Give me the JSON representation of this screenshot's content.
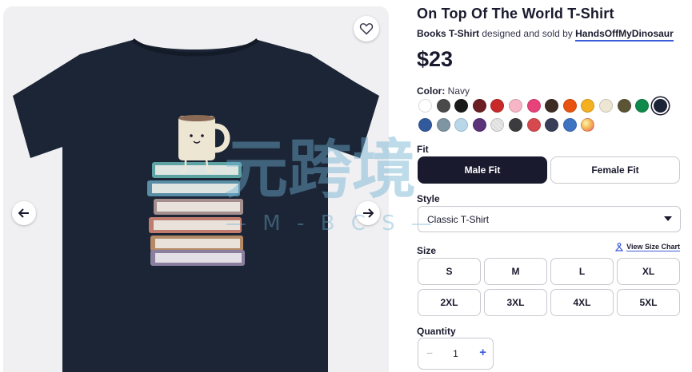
{
  "product": {
    "title": "On Top Of The World T-Shirt",
    "category": "Books T-Shirt",
    "byline_middle": " designed and sold by ",
    "seller": "HandsOffMyDinosaur",
    "price": "$23"
  },
  "gallery": {
    "icons": {
      "favorite": "heart-icon",
      "prev": "arrow-left-icon",
      "next": "arrow-right-icon"
    },
    "shirt_color": "#1b2536"
  },
  "color": {
    "label": "Color:",
    "selected": "Navy",
    "swatches": [
      {
        "name": "White",
        "hex": "#ffffff"
      },
      {
        "name": "Dark Heather",
        "hex": "#4a4a4a"
      },
      {
        "name": "Black",
        "hex": "#1a1a1a"
      },
      {
        "name": "Maroon",
        "hex": "#6b1f22"
      },
      {
        "name": "Red",
        "hex": "#c82a2a"
      },
      {
        "name": "Light Pink",
        "hex": "#f7b6c8"
      },
      {
        "name": "Heliconia",
        "hex": "#e8427a"
      },
      {
        "name": "Dark Chocolate",
        "hex": "#3e2c24"
      },
      {
        "name": "Orange",
        "hex": "#e8540f"
      },
      {
        "name": "Gold",
        "hex": "#f3b021"
      },
      {
        "name": "Natural",
        "hex": "#ede6d3"
      },
      {
        "name": "Military Green",
        "hex": "#5b5435"
      },
      {
        "name": "Kelly Green",
        "hex": "#0f8a4a"
      },
      {
        "name": "Navy",
        "hex": "#1b2536"
      },
      {
        "name": "Royal",
        "hex": "#315a9c"
      },
      {
        "name": "Heather Blue",
        "hex": "#7e95a4"
      },
      {
        "name": "Light Blue",
        "hex": "#b8d8ea"
      },
      {
        "name": "Purple",
        "hex": "#5c3279"
      },
      {
        "name": "Heather Grey",
        "hex": "#e7e7e7"
      },
      {
        "name": "Charcoal",
        "hex": "#3c3c3f"
      },
      {
        "name": "Heather Red",
        "hex": "#d64a4f"
      },
      {
        "name": "Heather Navy",
        "hex": "#383e58"
      },
      {
        "name": "Heather Royal",
        "hex": "#3e73c2"
      },
      {
        "name": "Tie Dye",
        "hex": "#f4bb56"
      }
    ]
  },
  "fit": {
    "label": "Fit",
    "options": [
      "Male Fit",
      "Female Fit"
    ],
    "selected": "Male Fit"
  },
  "style": {
    "label": "Style",
    "selected": "Classic T-Shirt"
  },
  "size": {
    "label": "Size",
    "chart_link": "View Size Chart",
    "options": [
      "S",
      "M",
      "L",
      "XL",
      "2XL",
      "3XL",
      "4XL",
      "5XL"
    ]
  },
  "quantity": {
    "label": "Quantity",
    "value": "1",
    "minus": "−",
    "plus": "+"
  },
  "watermark": {
    "text": "元跨境",
    "sub": "— M - B C S —"
  }
}
